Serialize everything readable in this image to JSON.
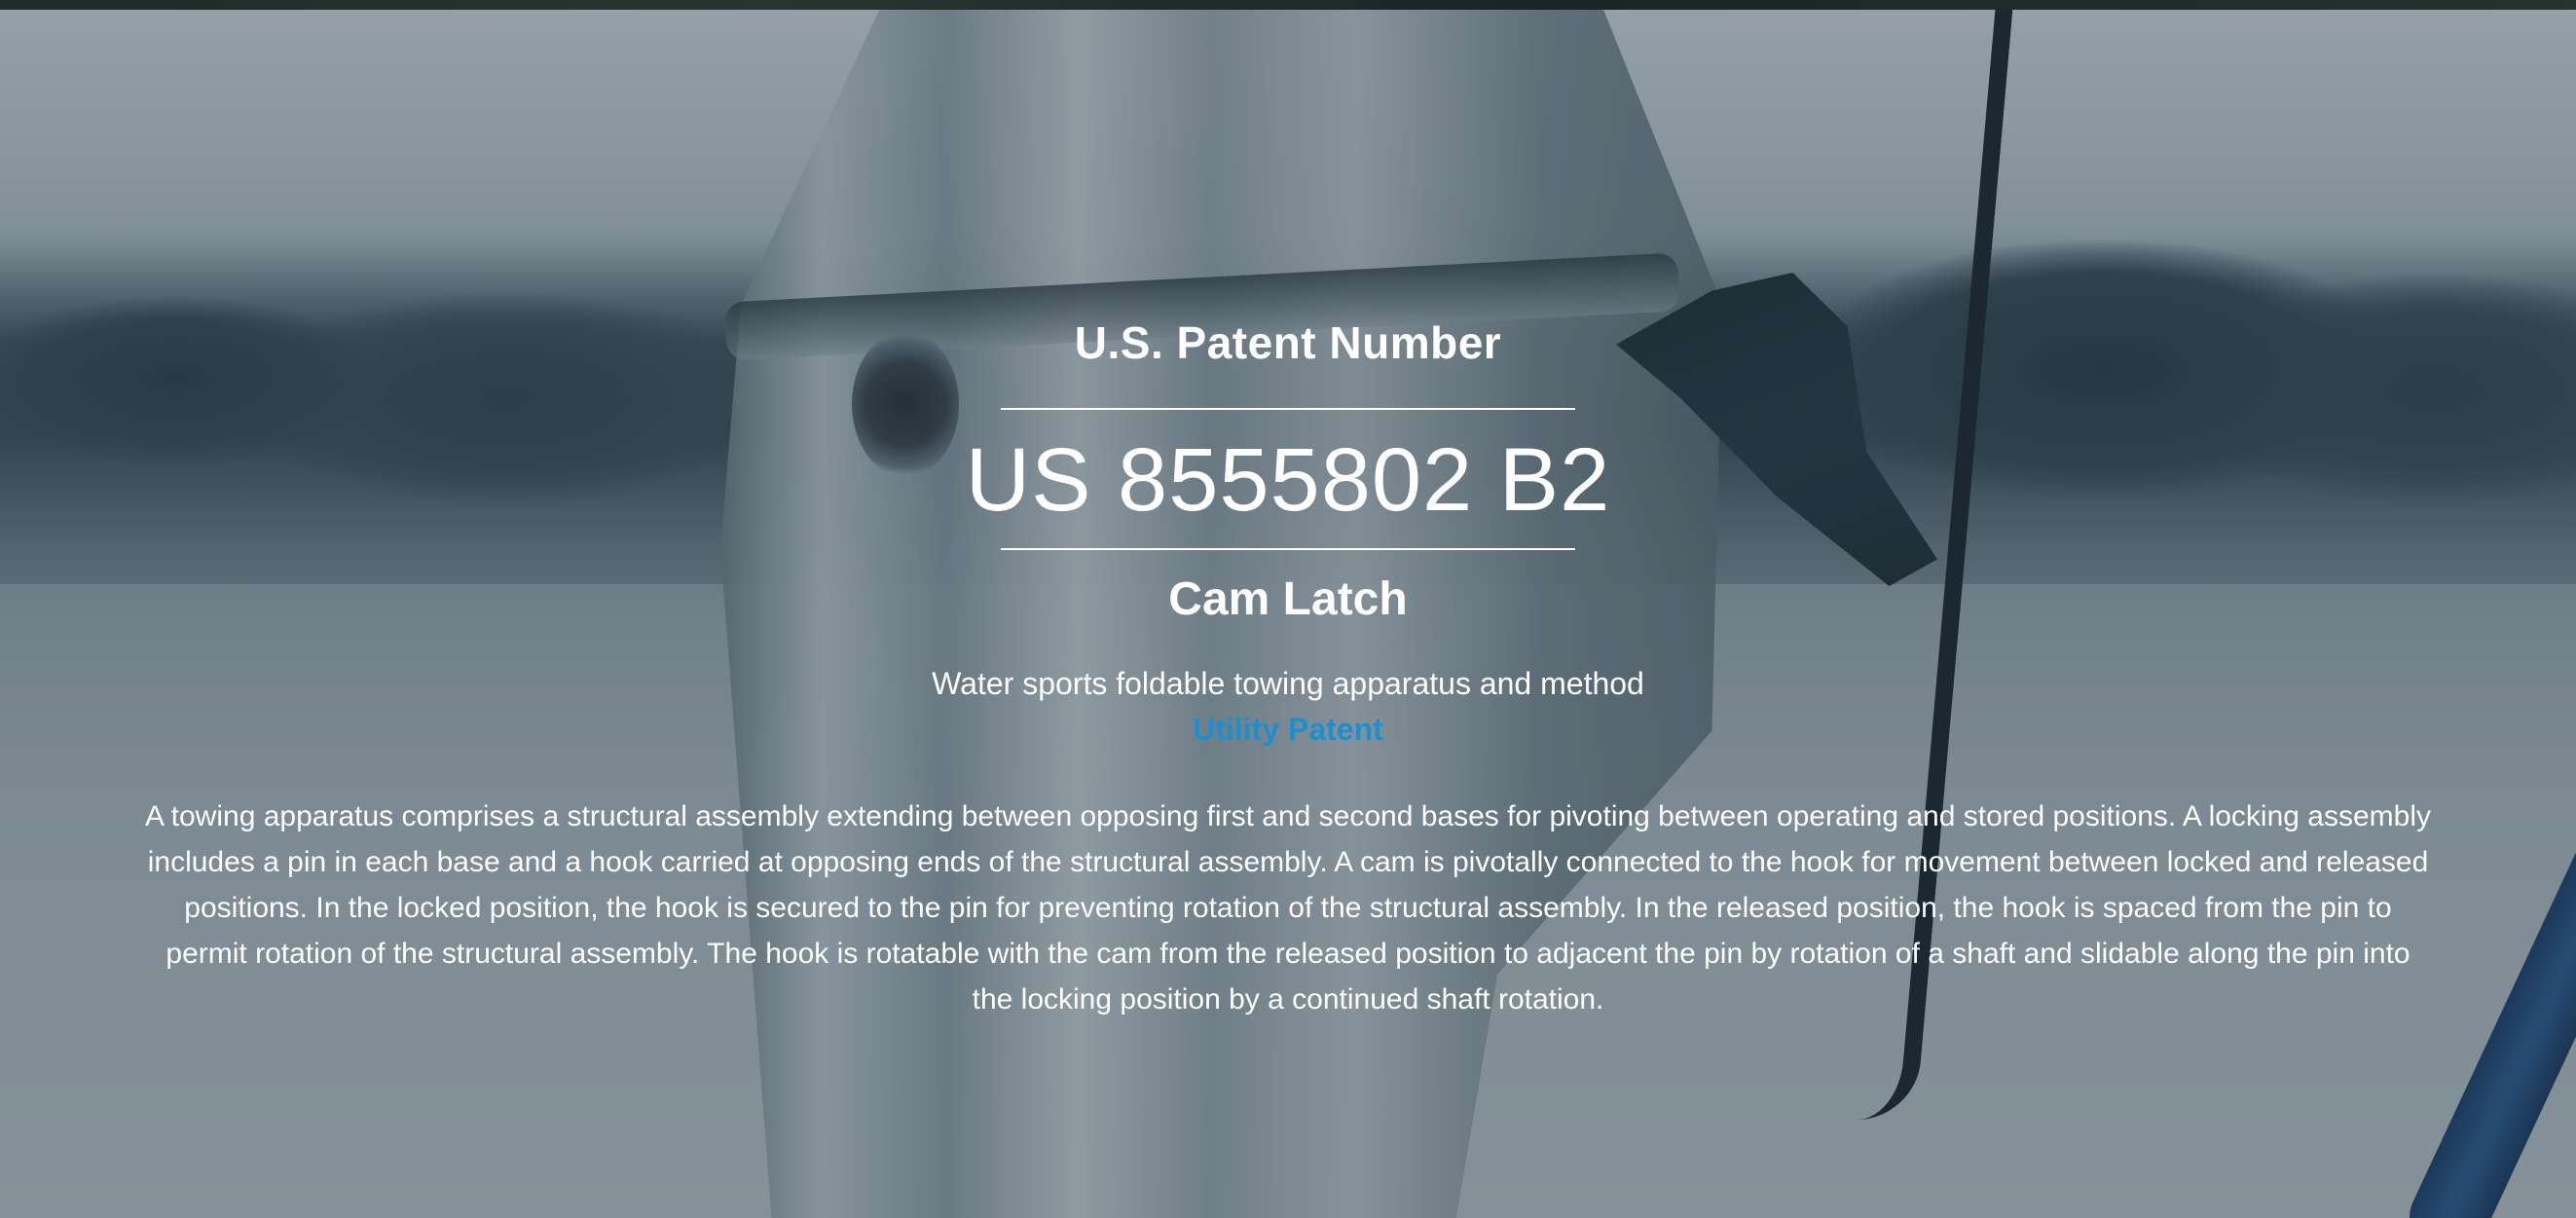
{
  "hero": {
    "label": "U.S. Patent Number",
    "patent_number": "US 8555802 B2",
    "title": "Cam Latch",
    "subtitle": "Water sports foldable towing apparatus and method",
    "patent_type": "Utility Patent",
    "abstract": "A towing apparatus comprises a structural assembly extending between opposing first and second bases for pivoting between operating and stored positions. A locking assembly includes a pin in each base and a hook carried at opposing ends of the structural assembly. A cam is pivotally connected to the hook for movement between locked and released positions. In the locked position, the hook is secured to the pin for preventing rotation of the structural assembly. In the released position, the hook is spaced from the pin to permit rotation of the structural assembly. The hook is rotatable with the cam from the released position to adjacent the pin by rotation of a shaft and slidable along the pin into the locking position by a continued shaft rotation."
  },
  "colors": {
    "text": "#ffffff",
    "accent": "#1a8fd1",
    "overlay": "#1c303e"
  }
}
